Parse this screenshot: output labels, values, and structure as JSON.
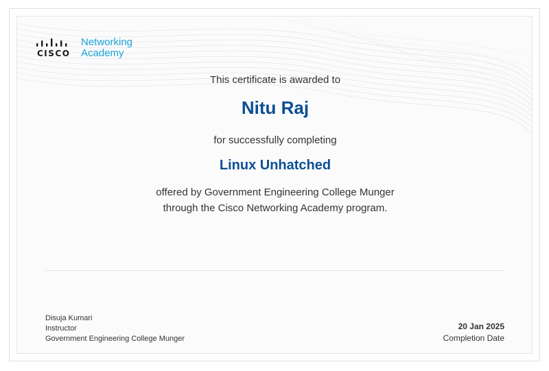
{
  "logo": {
    "wordmark": "CISCO",
    "line1": "Networking",
    "line2": "Academy",
    "accent_color": "#1aa4d6"
  },
  "certificate": {
    "awarded_text": "This certificate is awarded to",
    "recipient_name": "Nitu Raj",
    "completing_text": "for successfully completing",
    "course_name": "Linux Unhatched",
    "offered_line1": "offered by Government Engineering College Munger",
    "offered_line2": "through the Cisco Networking Academy program.",
    "highlight_color": "#0b4f93"
  },
  "instructor": {
    "name": "Disuja Kumari",
    "role": "Instructor",
    "institution": "Government Engineering College Munger"
  },
  "completion": {
    "date": "20 Jan 2025",
    "label": "Completion Date"
  }
}
